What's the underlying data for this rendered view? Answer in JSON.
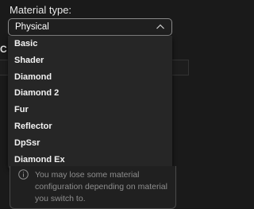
{
  "field": {
    "label": "Material type:",
    "selected": "Physical"
  },
  "dropdown": {
    "options": [
      "Basic",
      "Shader",
      "Diamond",
      "Diamond 2",
      "Fur",
      "Reflector",
      "DpSsr",
      "Diamond Ex"
    ]
  },
  "notice": {
    "icon": "info-icon",
    "text": "You may lose some material configuration depending on material you switch to."
  },
  "hidden": {
    "partial_letter": "C"
  }
}
